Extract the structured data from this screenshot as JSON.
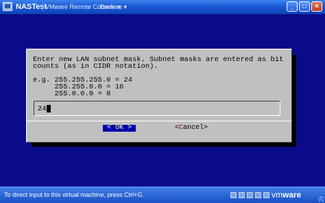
{
  "window": {
    "title": "NASTest",
    "tabs": [
      "VMware Remote Console",
      "Devices"
    ],
    "controls": {
      "minimize": "_",
      "maximize": "□",
      "close": "×"
    }
  },
  "console": {
    "prompt_line1": "Enter new LAN subnet mask. Subnet masks are entered as bit",
    "prompt_line2": "counts (as in CIDR notation).",
    "example_line1": "e.g. 255.255.255.0 = 24",
    "example_line2": "     255.255.0.0 = 16",
    "example_line3": "     255.0.0.0 = 8",
    "input_value": "24",
    "ok": {
      "left": "< ",
      "hotkey": "O",
      "rest": "K",
      "right": " >"
    },
    "cancel": {
      "left": "<",
      "hotkey": "C",
      "rest": "ancel",
      "right": ">"
    }
  },
  "statusbar": {
    "text": "To direct input to this virtual machine, press Ctrl+G.",
    "brand": "vm",
    "brand_suffix": "ware"
  }
}
